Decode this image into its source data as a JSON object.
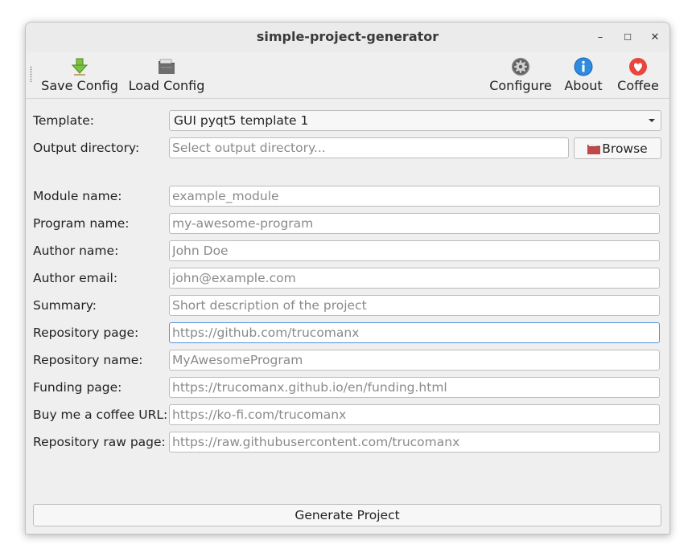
{
  "window": {
    "title": "simple-project-generator"
  },
  "window_controls": {
    "minimize": "–",
    "maximize": "☐",
    "close": "✕"
  },
  "toolbar": {
    "save_config": "Save Config",
    "load_config": "Load Config",
    "configure": "Configure",
    "about": "About",
    "coffee": "Coffee"
  },
  "form": {
    "template": {
      "label": "Template:",
      "value": "GUI pyqt5 template 1"
    },
    "output_directory": {
      "label": "Output directory:",
      "placeholder": "Select output directory...",
      "browse_label": "Browse"
    },
    "module_name": {
      "label": "Module name:",
      "placeholder": "example_module"
    },
    "program_name": {
      "label": "Program name:",
      "placeholder": "my-awesome-program"
    },
    "author_name": {
      "label": "Author name:",
      "placeholder": "John Doe"
    },
    "author_email": {
      "label": "Author email:",
      "placeholder": "john@example.com"
    },
    "summary": {
      "label": "Summary:",
      "placeholder": "Short description of the project"
    },
    "repository_page": {
      "label": "Repository page:",
      "placeholder": "https://github.com/trucomanx"
    },
    "repository_name": {
      "label": "Repository name:",
      "placeholder": "MyAwesomeProgram"
    },
    "funding_page": {
      "label": "Funding page:",
      "placeholder": "https://trucomanx.github.io/en/funding.html"
    },
    "buy_me_coffee": {
      "label": "Buy me a coffee URL:",
      "placeholder": "https://ko-fi.com/trucomanx"
    },
    "repository_raw_page": {
      "label": "Repository raw page:",
      "placeholder": "https://raw.githubusercontent.com/trucomanx"
    }
  },
  "generate_button": "Generate Project",
  "icons": {
    "save": "green-download-arrow-icon",
    "load": "folder-icon",
    "configure": "gear-icon",
    "about": "info-icon",
    "coffee": "heart-icon",
    "browse": "folder-icon"
  },
  "colors": {
    "accent": "#5294e2",
    "save_icon": "#7cc242",
    "about_icon": "#2f8be0",
    "coffee_icon": "#e8453c"
  }
}
